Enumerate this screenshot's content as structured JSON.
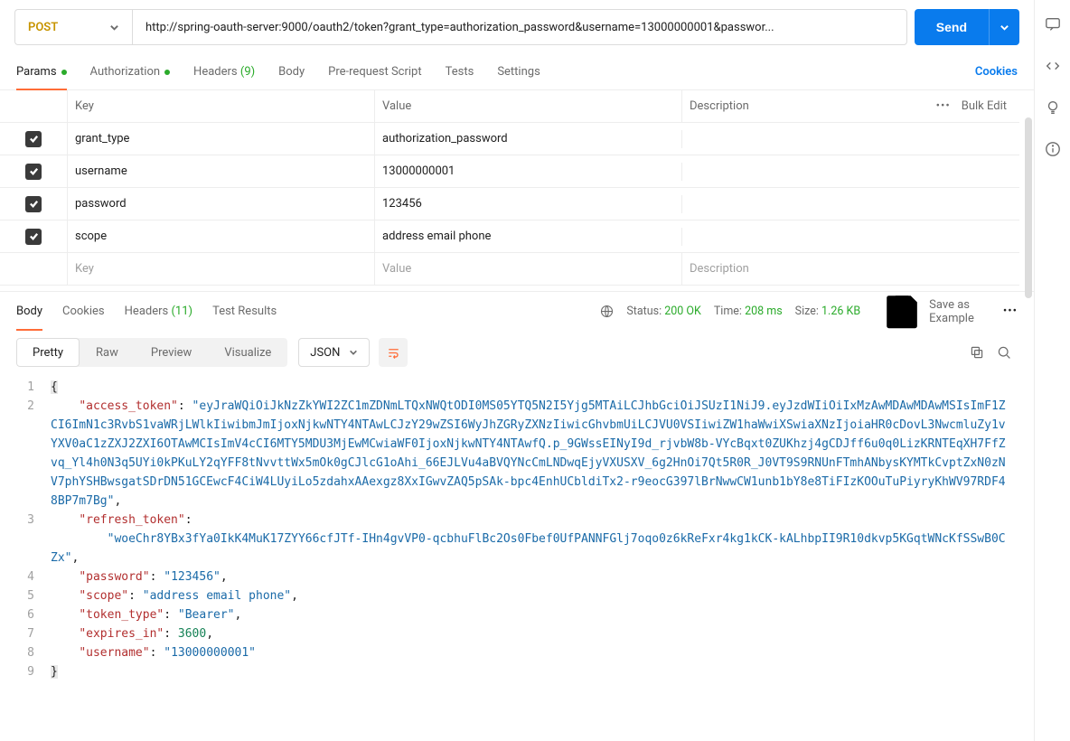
{
  "request": {
    "method": "POST",
    "url": "http://spring-oauth-server:9000/oauth2/token?grant_type=authorization_password&username=13000000001&passwor...",
    "send_label": "Send"
  },
  "tabs": {
    "params": "Params",
    "authorization": "Authorization",
    "headers": "Headers",
    "headers_count": "(9)",
    "body": "Body",
    "pre_request": "Pre-request Script",
    "tests": "Tests",
    "settings": "Settings",
    "cookies": "Cookies"
  },
  "params_table": {
    "head_key": "Key",
    "head_value": "Value",
    "head_desc": "Description",
    "bulk_edit": "Bulk Edit",
    "rows": [
      {
        "key": "grant_type",
        "value": "authorization_password",
        "desc": ""
      },
      {
        "key": "username",
        "value": "13000000001",
        "desc": ""
      },
      {
        "key": "password",
        "value": "123456",
        "desc": ""
      },
      {
        "key": "scope",
        "value": "address email phone",
        "desc": ""
      }
    ],
    "ph_key": "Key",
    "ph_value": "Value",
    "ph_desc": "Description"
  },
  "response_tabs": {
    "body": "Body",
    "cookies": "Cookies",
    "headers": "Headers",
    "headers_count": "(11)",
    "test_results": "Test Results"
  },
  "response_meta": {
    "status_label": "Status:",
    "status_value": "200 OK",
    "time_label": "Time:",
    "time_value": "208 ms",
    "size_label": "Size:",
    "size_value": "1.26 KB",
    "save_example": "Save as Example"
  },
  "view": {
    "pretty": "Pretty",
    "raw": "Raw",
    "preview": "Preview",
    "visualize": "Visualize",
    "format": "JSON"
  },
  "json_body": {
    "access_token": "eyJraWQiOiJkNzZkYWI2ZC1mZDNmLTQxNWQtODI0MS05YTQ5N2I5Yjg5MTAiLCJhbGciOiJSUzI1NiJ9.eyJzdWIiOiIxMzAwMDAwMDAwMSIsImF1ZCI6ImN1c3RvbS1vaWRjLWlkIiwibmJmIjoxNjkwNTY4NTAwLCJzY29wZSI6WyJhZGRyZXNzIiwicGhvbmUiLCJVU0VSIiwiZW1haWwiXSwiaXNzIjoiaHR0cDovL3NwcmluZy1vYXV0aC1zZXJ2ZXI6OTAwMCIsImV4cCI6MTY5MDU3MjEwMCwiaWF0IjoxNjkwNTY4NTAwfQ.p_9GWssEINyI9d_rjvbW8b-VYcBqxt0ZUKhzj4gCDJff6u0q0LizKRNTEqXH7FfZvq_Yl4h0N3q5UYi0kPKuLY2qYFF8tNvvttWx5mOk0gCJlcG1oAhi_66EJLVu4aBVQYNcCmLNDwqEjyVXUSXV_6g2HnOi7Qt5R0R_J0VT9S9RNUnFTmhANbysKYMTkCvptZxN0zNV7phYSHBwsgatSDrDN51GCEwcF4CiW4LUyiLo5zdahxAAexgz8XxIGwvZAQ5pSAk-bpc4EnhUCbldiTx2-r9eocG397lBrNwwCW1unb1bY8e8TiFIzKOOuTuPiyryKhWV97RDF48BP7m7Bg",
    "refresh_token": "woeChr8YBx3fYa0IkK4MuK17ZYY66cfJTf-IHn4gvVP0-qcbhuFlBc2Os0Fbef0UfPANNFGlj7oqo0z6kReFxr4kg1kCK-kALhbpII9R10dkvp5KGqtWNcKfSSwB0CZx",
    "password": "123456",
    "scope": "address email phone",
    "token_type": "Bearer",
    "expires_in": 3600,
    "username": "13000000001"
  }
}
